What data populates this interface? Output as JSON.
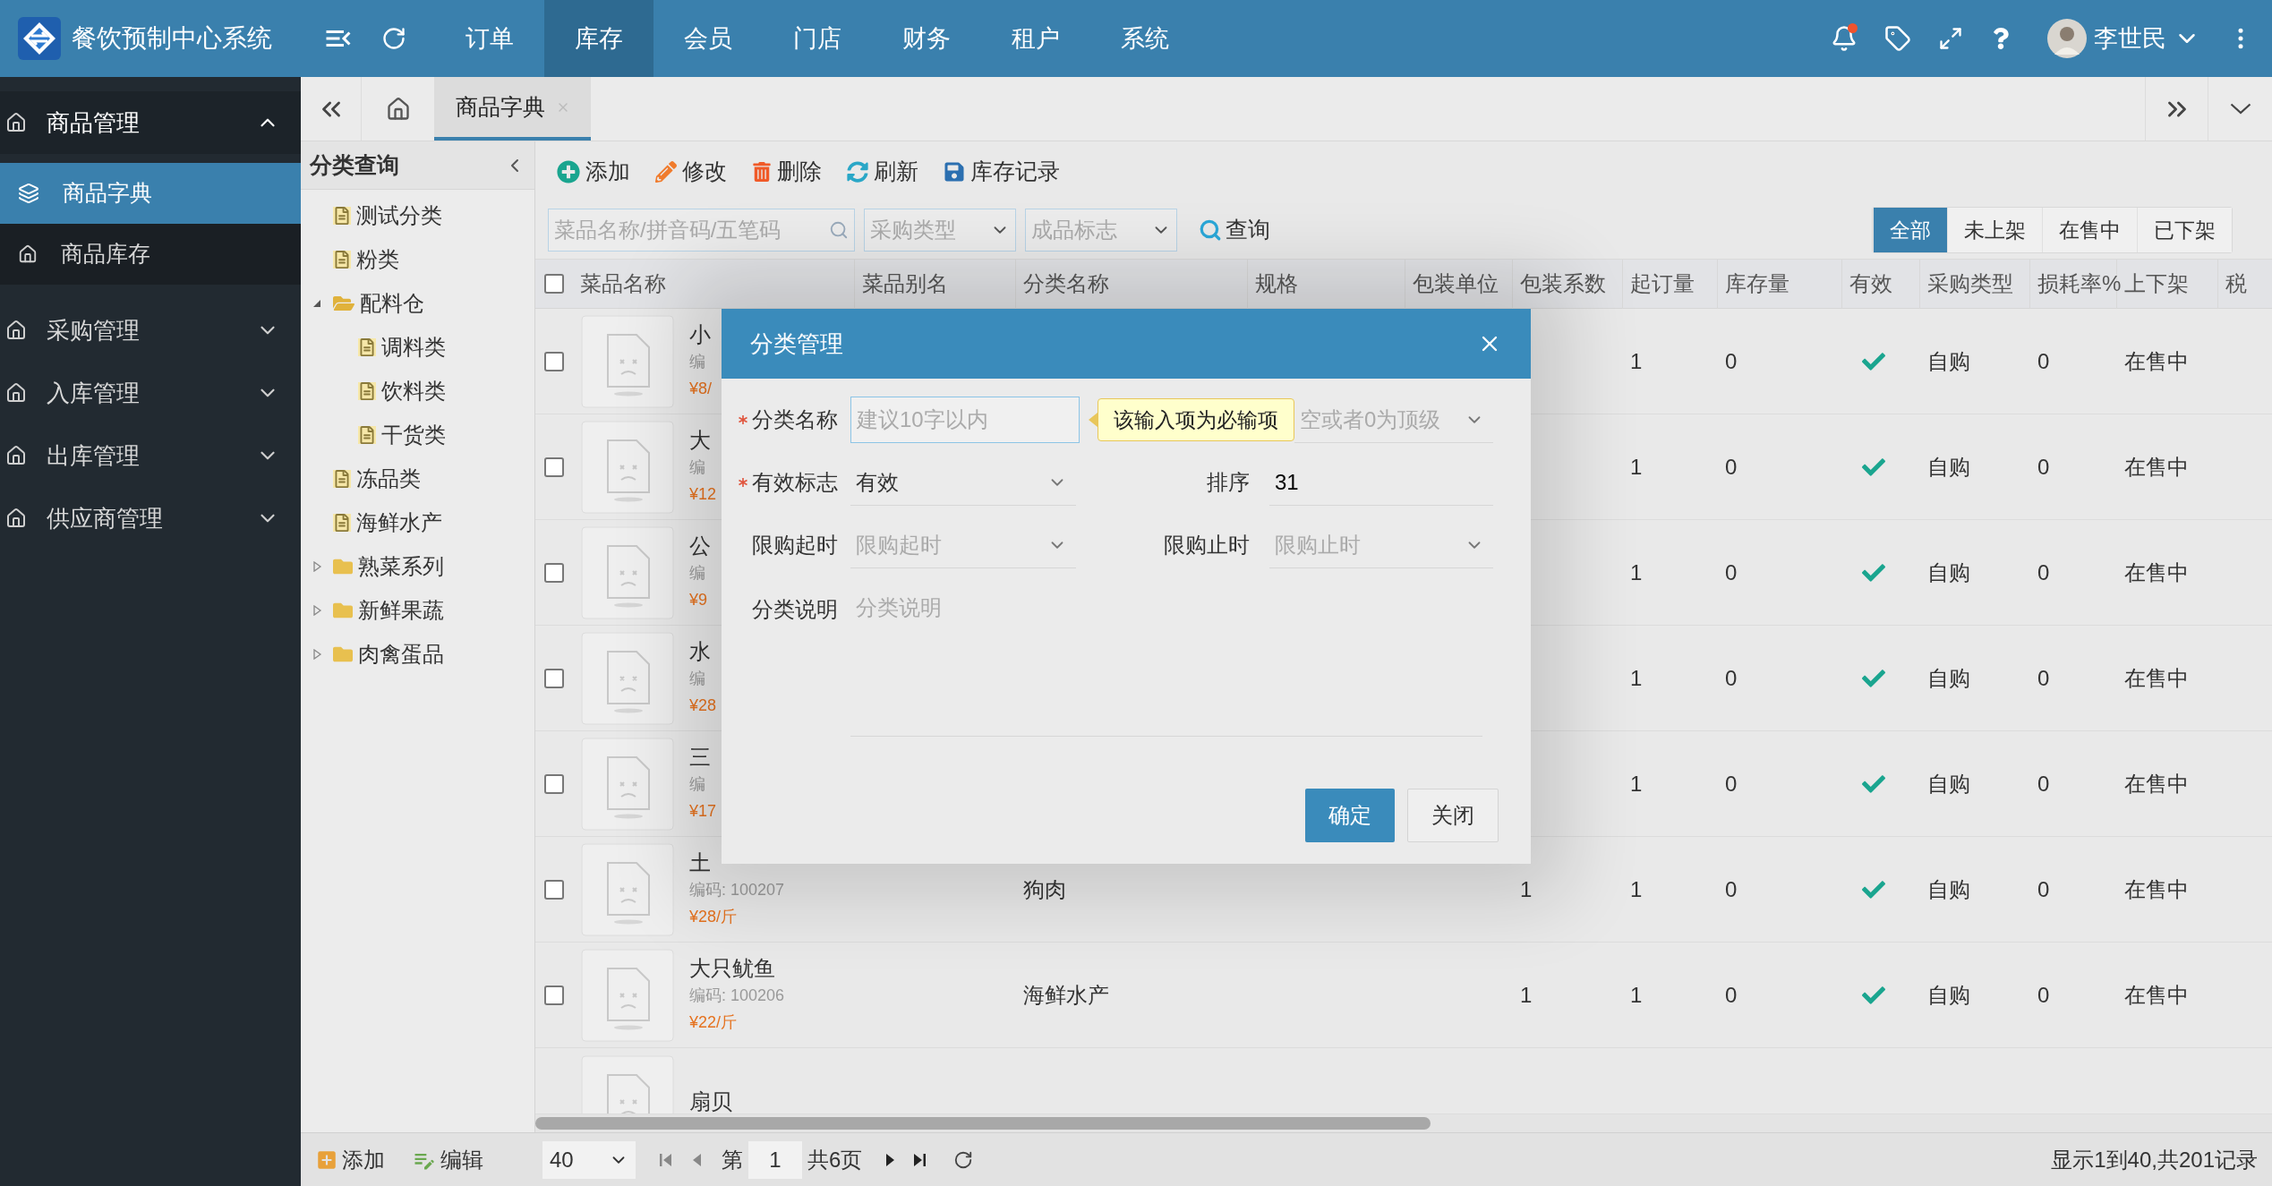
{
  "app": {
    "title": "餐饮预制中心系统",
    "user": "李世民",
    "has_notification": true
  },
  "nav": [
    {
      "label": "订单",
      "selected": false
    },
    {
      "label": "库存",
      "selected": true
    },
    {
      "label": "会员",
      "selected": false
    },
    {
      "label": "门店",
      "selected": false
    },
    {
      "label": "财务",
      "selected": false
    },
    {
      "label": "租户",
      "selected": false
    },
    {
      "label": "系统",
      "selected": false
    }
  ],
  "sidebar": [
    {
      "label": "商品管理",
      "expanded": true,
      "items": [
        {
          "label": "商品字典",
          "selected": true
        },
        {
          "label": "商品库存",
          "selected": false
        }
      ]
    },
    {
      "label": "采购管理",
      "expanded": false
    },
    {
      "label": "入库管理",
      "expanded": false
    },
    {
      "label": "出库管理",
      "expanded": false
    },
    {
      "label": "供应商管理",
      "expanded": false
    }
  ],
  "tabs": [
    {
      "label": "商品字典",
      "selected": true
    }
  ],
  "category_tree": {
    "title": "分类查询",
    "items": [
      {
        "label": "测试分类",
        "kind": "leaf"
      },
      {
        "label": "粉类",
        "kind": "leaf"
      },
      {
        "label": "配料仓",
        "kind": "folder",
        "expanded": true,
        "children": [
          {
            "label": "调料类",
            "kind": "leaf"
          },
          {
            "label": "饮料类",
            "kind": "leaf"
          },
          {
            "label": "干货类",
            "kind": "leaf"
          }
        ]
      },
      {
        "label": "冻品类",
        "kind": "leaf"
      },
      {
        "label": "海鲜水产",
        "kind": "leaf"
      },
      {
        "label": "熟菜系列",
        "kind": "folder",
        "expanded": false
      },
      {
        "label": "新鲜果蔬",
        "kind": "folder",
        "expanded": false
      },
      {
        "label": "肉禽蛋品",
        "kind": "folder",
        "expanded": false
      }
    ]
  },
  "toolbar": [
    {
      "label": "添加",
      "kind": "add"
    },
    {
      "label": "修改",
      "kind": "edit"
    },
    {
      "label": "删除",
      "kind": "delete"
    },
    {
      "label": "刷新",
      "kind": "refresh"
    },
    {
      "label": "库存记录",
      "kind": "record"
    }
  ],
  "filters": {
    "search_placeholder": "菜品名称/拼音码/五笔码",
    "selects": [
      {
        "placeholder": "采购类型"
      },
      {
        "placeholder": "成品标志"
      }
    ],
    "query": "查询",
    "status_tabs": [
      {
        "label": "全部",
        "selected": true
      },
      {
        "label": "未上架",
        "selected": false
      },
      {
        "label": "在售中",
        "selected": false
      },
      {
        "label": "已下架",
        "selected": false
      }
    ]
  },
  "table": {
    "select_all_checked": false,
    "columns": [
      "菜品名称",
      "菜品别名",
      "分类名称",
      "规格",
      "包装单位",
      "包装系数",
      "起订量",
      "库存量",
      "有效",
      "采购类型",
      "损耗率%",
      "上下架",
      "税"
    ],
    "rows": [
      {
        "checked": false,
        "name": "小",
        "code": "编",
        "price": "¥8/",
        "min_order": "1",
        "stock": "0",
        "valid": true,
        "purchase_type": "自购",
        "loss_rate": "0",
        "shelf": "在售中"
      },
      {
        "checked": false,
        "name": "大",
        "code": "编",
        "price": "¥12",
        "min_order": "1",
        "stock": "0",
        "valid": true,
        "purchase_type": "自购",
        "loss_rate": "0",
        "shelf": "在售中"
      },
      {
        "checked": false,
        "name": "公",
        "code": "编",
        "price": "¥9",
        "min_order": "1",
        "stock": "0",
        "valid": true,
        "purchase_type": "自购",
        "loss_rate": "0",
        "shelf": "在售中"
      },
      {
        "checked": false,
        "name": "水",
        "code": "编",
        "price": "¥28",
        "min_order": "1",
        "stock": "0",
        "valid": true,
        "purchase_type": "自购",
        "loss_rate": "0",
        "shelf": "在售中"
      },
      {
        "checked": false,
        "name": "三",
        "code": "编",
        "price": "¥17",
        "min_order": "1",
        "stock": "0",
        "valid": true,
        "purchase_type": "自购",
        "loss_rate": "0",
        "shelf": "在售中"
      },
      {
        "checked": false,
        "name": "土",
        "code": "编码: 100207",
        "price": "¥28/斤",
        "category": "狗肉",
        "pack_factor": "1",
        "min_order": "1",
        "stock": "0",
        "valid": true,
        "purchase_type": "自购",
        "loss_rate": "0",
        "shelf": "在售中"
      },
      {
        "checked": false,
        "name": "大只鱿鱼",
        "code": "编码: 100206",
        "price": "¥22/斤",
        "category": "海鲜水产",
        "pack_factor": "1",
        "min_order": "1",
        "stock": "0",
        "valid": true,
        "purchase_type": "自购",
        "loss_rate": "0",
        "shelf": "在售中"
      },
      {
        "name": "扇贝"
      }
    ]
  },
  "pager": {
    "buttons": [
      {
        "label": "添加",
        "kind": "add"
      },
      {
        "label": "编辑",
        "kind": "edit"
      }
    ],
    "page_size": "40",
    "page_prefix": "第",
    "page": "1",
    "page_suffix": "共6页",
    "summary": "显示1到40,共201记录"
  },
  "dialog": {
    "title": "分类管理",
    "name_field": {
      "label": "分类名称",
      "required": true,
      "placeholder": "建议10字以内",
      "focused": true
    },
    "tooltip": "该输入项为必输项",
    "parent_select": {
      "placeholder": "空或者0为顶级"
    },
    "valid_select": {
      "label": "有效标志",
      "required": true,
      "value": "有效"
    },
    "sort_field": {
      "label": "排序",
      "value": "31"
    },
    "start_select": {
      "label": "限购起时",
      "placeholder": "限购起时"
    },
    "end_select": {
      "label": "限购止时",
      "placeholder": "限购止时"
    },
    "description": {
      "label": "分类说明",
      "placeholder": "分类说明"
    },
    "buttons": [
      {
        "label": "确定",
        "kind": "primary"
      },
      {
        "label": "关闭",
        "kind": "default"
      }
    ]
  }
}
